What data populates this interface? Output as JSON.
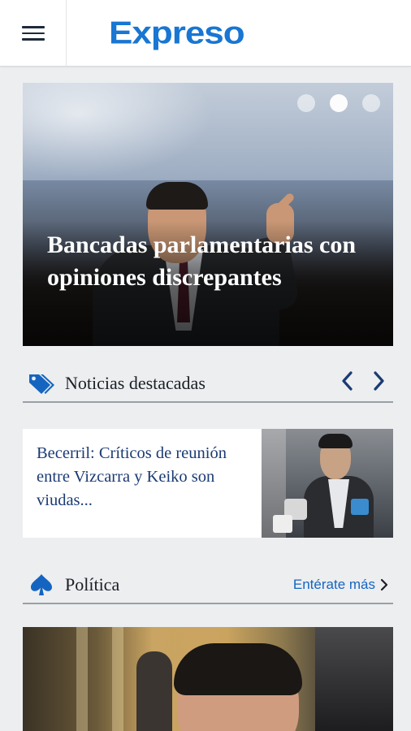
{
  "header": {
    "menu_icon": "hamburger-icon",
    "logo_text": "Expreso",
    "brand_color": "#1976d2"
  },
  "hero": {
    "title": "Bancadas parlamentarias con opiniones discrepantes",
    "slides_count": 3,
    "active_slide": 2
  },
  "featured_section": {
    "icon": "tags-icon",
    "title": "Noticias destacadas",
    "prev_icon": "chevron-left-icon",
    "next_icon": "chevron-right-icon"
  },
  "featured_card": {
    "headline": "Becerril: Críticos de reunión entre Vizcarra y Keiko son viudas..."
  },
  "politics_section": {
    "icon": "spade-icon",
    "title": "Política",
    "more_label": "Entérate más",
    "more_icon": "chevron-right-icon",
    "link_color": "#1565c0"
  }
}
